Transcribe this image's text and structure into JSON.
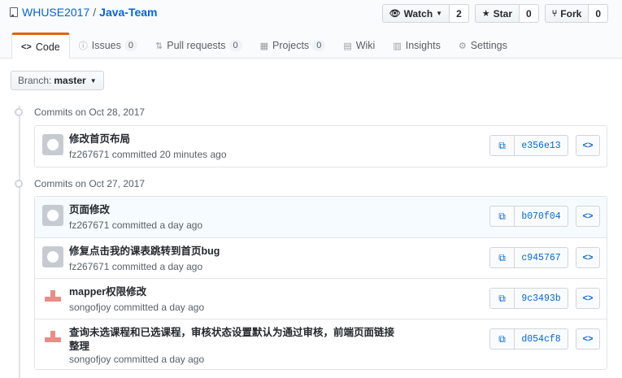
{
  "repo": {
    "owner": "WHUSE2017",
    "separator": "/",
    "name": "Java-Team"
  },
  "actions": {
    "watch": {
      "label": "Watch",
      "count": "2"
    },
    "star": {
      "label": "Star",
      "count": "0"
    },
    "fork": {
      "label": "Fork",
      "count": "0"
    }
  },
  "tabs": [
    {
      "label": "Code",
      "icon": "code-icon"
    },
    {
      "label": "Issues",
      "icon": "issue-icon",
      "count": "0"
    },
    {
      "label": "Pull requests",
      "icon": "pull-request-icon",
      "count": "0"
    },
    {
      "label": "Projects",
      "icon": "project-icon",
      "count": "0"
    },
    {
      "label": "Wiki",
      "icon": "book-icon"
    },
    {
      "label": "Insights",
      "icon": "graph-icon"
    },
    {
      "label": "Settings",
      "icon": "gear-icon"
    }
  ],
  "branch": {
    "label": "Branch:",
    "value": "master"
  },
  "groups": [
    {
      "title": "Commits on Oct 28, 2017",
      "commits": [
        {
          "message": "修改首页布局",
          "author": "fz267671",
          "verb": "committed",
          "time": "20 minutes ago",
          "sha": "e356e13",
          "avatar": "github-default-icon"
        }
      ]
    },
    {
      "title": "Commits on Oct 27, 2017",
      "commits": [
        {
          "message": "页面修改",
          "author": "fz267671",
          "verb": "committed",
          "time": "a day ago",
          "sha": "b070f04",
          "avatar": "github-default-icon"
        },
        {
          "message": "修复点击我的课表跳转到首页bug",
          "author": "fz267671",
          "verb": "committed",
          "time": "a day ago",
          "sha": "c945767",
          "avatar": "github-default-icon"
        },
        {
          "message": "mapper权限修改",
          "author": "songofjoy",
          "verb": "committed",
          "time": "a day ago",
          "sha": "9c3493b",
          "avatar": "identicon"
        },
        {
          "message": "查询未选课程和已选课程，审核状态设置默认为通过审核，前端页面链接整理",
          "author": "songofjoy",
          "verb": "committed",
          "time": "a day ago",
          "sha": "d054cf8",
          "avatar": "identicon"
        }
      ]
    }
  ],
  "colors": {
    "link": "#0366d6",
    "active_tab_accent": "#e36209",
    "identicon": "#e88e86"
  }
}
